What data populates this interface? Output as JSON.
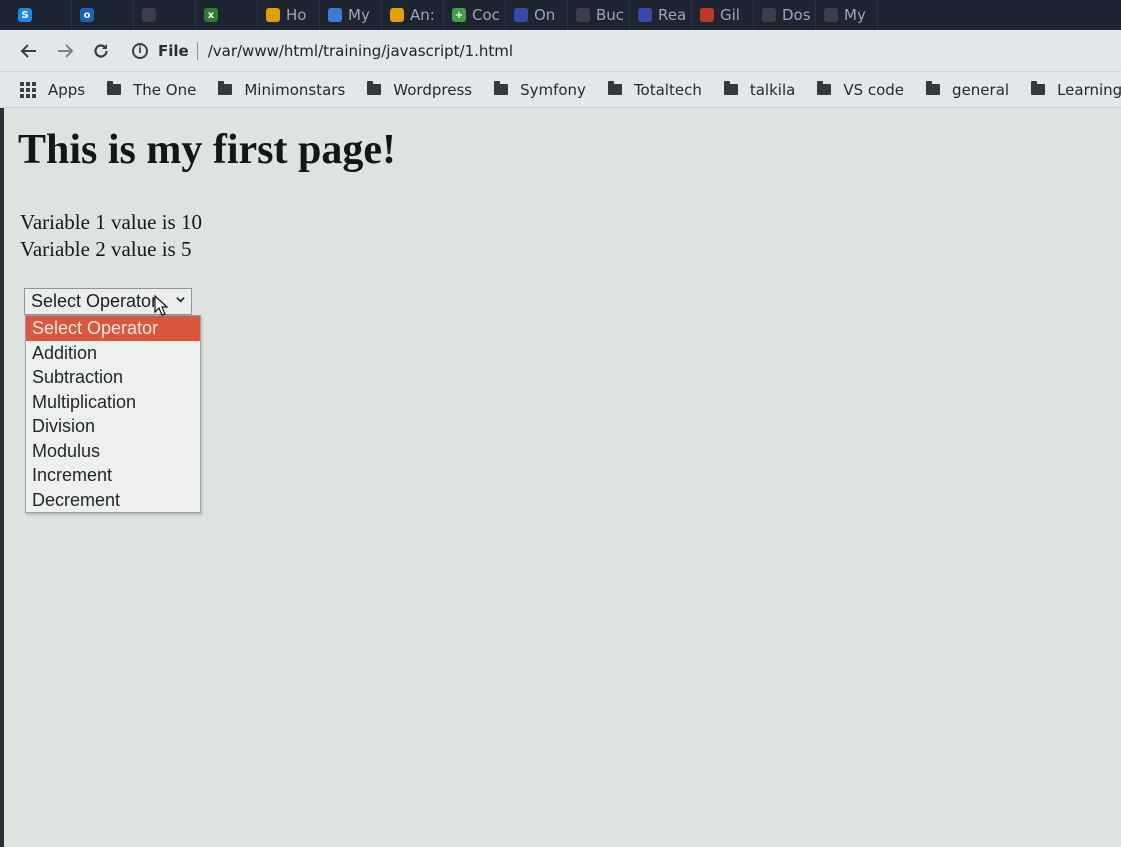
{
  "browser": {
    "tabs": [
      {
        "label": "",
        "icon": "skype-icon",
        "color": "#1e88e5",
        "glyph": "S"
      },
      {
        "label": "",
        "icon": "outlook-icon",
        "color": "#1565c0",
        "glyph": "o"
      },
      {
        "label": "",
        "icon": "tab-favicon-icon",
        "color": "#3a3f4a",
        "glyph": ""
      },
      {
        "label": "",
        "icon": "excel-icon",
        "color": "#2e7d32",
        "glyph": "x"
      },
      {
        "label": "Ho",
        "icon": "tab-favicon-icon",
        "color": "#e0a000",
        "glyph": ""
      },
      {
        "label": "My",
        "icon": "cloud-icon",
        "color": "#3a7bd5",
        "glyph": ""
      },
      {
        "label": "An:",
        "icon": "tab-favicon-icon",
        "color": "#e0a000",
        "glyph": ""
      },
      {
        "label": "Coc",
        "icon": "plus-icon",
        "color": "#43a047",
        "glyph": "+"
      },
      {
        "label": "On",
        "icon": "tab-favicon-icon",
        "color": "#3949ab",
        "glyph": ""
      },
      {
        "label": "Buc",
        "icon": "tab-favicon-icon",
        "color": "#3a3f4a",
        "glyph": ""
      },
      {
        "label": "Rea",
        "icon": "tab-favicon-icon",
        "color": "#3949ab",
        "glyph": ""
      },
      {
        "label": "Gil",
        "icon": "tab-favicon-icon",
        "color": "#c0392b",
        "glyph": ""
      },
      {
        "label": "Dos",
        "icon": "tab-favicon-icon",
        "color": "#3a3f4a",
        "glyph": ""
      },
      {
        "label": "My",
        "icon": "tab-favicon-icon",
        "color": "#3a3f4a",
        "glyph": ""
      }
    ],
    "address": {
      "scheme_label": "File",
      "url": "/var/www/html/training/javascript/1.html"
    },
    "bookmarks": {
      "apps_label": "Apps",
      "items": [
        "The One",
        "Minimonstars",
        "Wordpress",
        "Symfony",
        "Totaltech",
        "talkila",
        "VS code",
        "general",
        "Learning"
      ]
    }
  },
  "page": {
    "heading": "This is my first page!",
    "lines": [
      "Variable 1 value is 10",
      "Variable 2 value is 5"
    ],
    "select": {
      "value": "Select Operator",
      "options": [
        "Select Operator",
        "Addition",
        "Subtraction",
        "Multiplication",
        "Division",
        "Modulus",
        "Increment",
        "Decrement"
      ],
      "highlighted_index": 0,
      "highlight_color": "#d9573d"
    }
  }
}
